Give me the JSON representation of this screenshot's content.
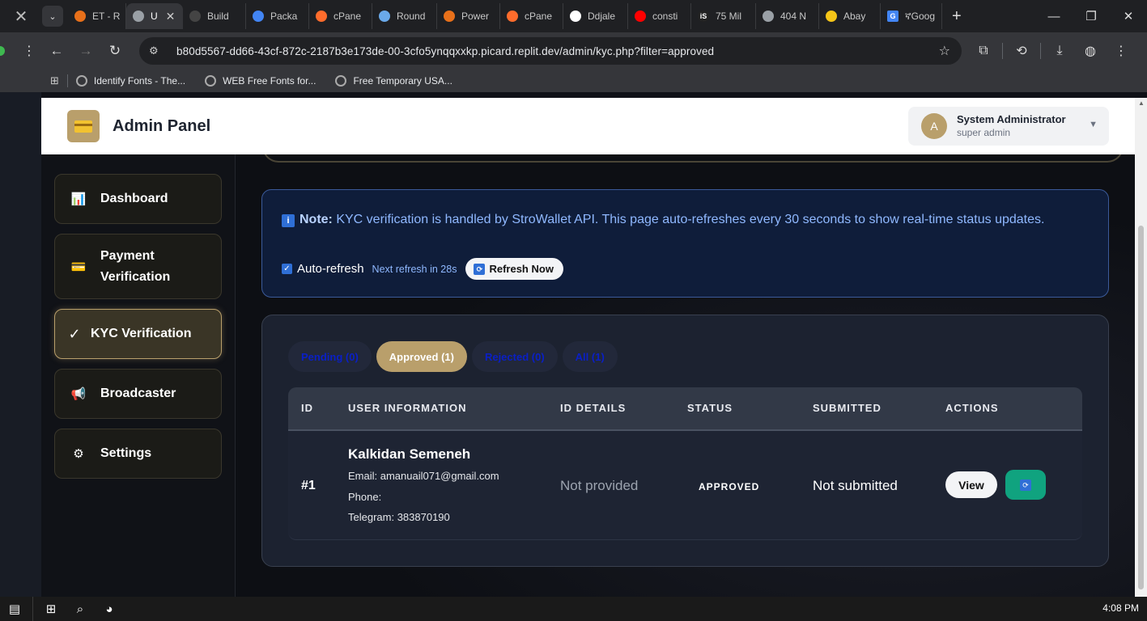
{
  "browser": {
    "tabs": [
      {
        "label": "ET - R",
        "fav_color": "#e8701a"
      },
      {
        "label": "U",
        "fav_color": "#9aa0a6",
        "active": true
      },
      {
        "label": "Build",
        "fav_color": "#444"
      },
      {
        "label": "Packa",
        "fav_color": "#4285f4"
      },
      {
        "label": "cPane",
        "fav_color": "#ff6c2c"
      },
      {
        "label": "Round",
        "fav_color": "#6aa9e9"
      },
      {
        "label": "Power",
        "fav_color": "#e8701a"
      },
      {
        "label": "cPane",
        "fav_color": "#ff6c2c"
      },
      {
        "label": "Ddjale",
        "fav_color": "#ffffff"
      },
      {
        "label": "consti",
        "fav_color": "#ff0000"
      },
      {
        "label": "75 Mil",
        "fav_color": "#222"
      },
      {
        "label": "404 N",
        "fav_color": "#9aa0a6"
      },
      {
        "label": "Abay",
        "fav_color": "#f5c518"
      },
      {
        "label": "ኛGoog",
        "fav_color": "#4285f4"
      }
    ],
    "url": "b80d5567-dd66-43cf-872c-2187b3e173de-00-3cfo5ynqqxxkp.picard.replit.dev/admin/kyc.php?filter=approved",
    "bookmarks": [
      "Identify Fonts - The...",
      "WEB Free Fonts for...",
      "Free Temporary USA..."
    ]
  },
  "header": {
    "brand": "Admin Panel",
    "user_initial": "A",
    "user_name": "System Administrator",
    "user_role": "super admin"
  },
  "sidebar": {
    "items": [
      {
        "label": "Dashboard",
        "icon": "📊"
      },
      {
        "label_line1": "Payment",
        "label_line2": "Verification",
        "icon": "💳"
      },
      {
        "label": "KYC Verification",
        "icon": "✓"
      },
      {
        "label": "Broadcaster",
        "icon": "📢"
      },
      {
        "label": "Settings",
        "icon": "⚙"
      }
    ]
  },
  "note": {
    "icon": "i",
    "strong": "Note:",
    "text": " KYC verification is handled by StroWallet API. This page auto-refreshes every 30 seconds to show real-time status updates.",
    "auto_refresh_label": "Auto-refresh",
    "auto_refresh_checked": true,
    "next_refresh": "Next refresh in 28s",
    "refresh_button": "Refresh Now"
  },
  "filters": [
    {
      "label": "Pending (0)",
      "active": false
    },
    {
      "label": "Approved (1)",
      "active": true
    },
    {
      "label": "Rejected (0)",
      "active": false
    },
    {
      "label": "All (1)",
      "active": false
    }
  ],
  "table": {
    "headers": [
      "ID",
      "USER INFORMATION",
      "ID DETAILS",
      "STATUS",
      "SUBMITTED",
      "ACTIONS"
    ],
    "rows": [
      {
        "id": "#1",
        "name": "Kalkidan Semeneh",
        "email": "Email: amanuail071@gmail.com",
        "phone": "Phone:",
        "telegram": "Telegram: 383870190",
        "id_details": "Not provided",
        "status": "APPROVED",
        "submitted": "Not submitted",
        "view_label": "View"
      }
    ]
  },
  "taskbar": {
    "time": "4:08 PM"
  }
}
